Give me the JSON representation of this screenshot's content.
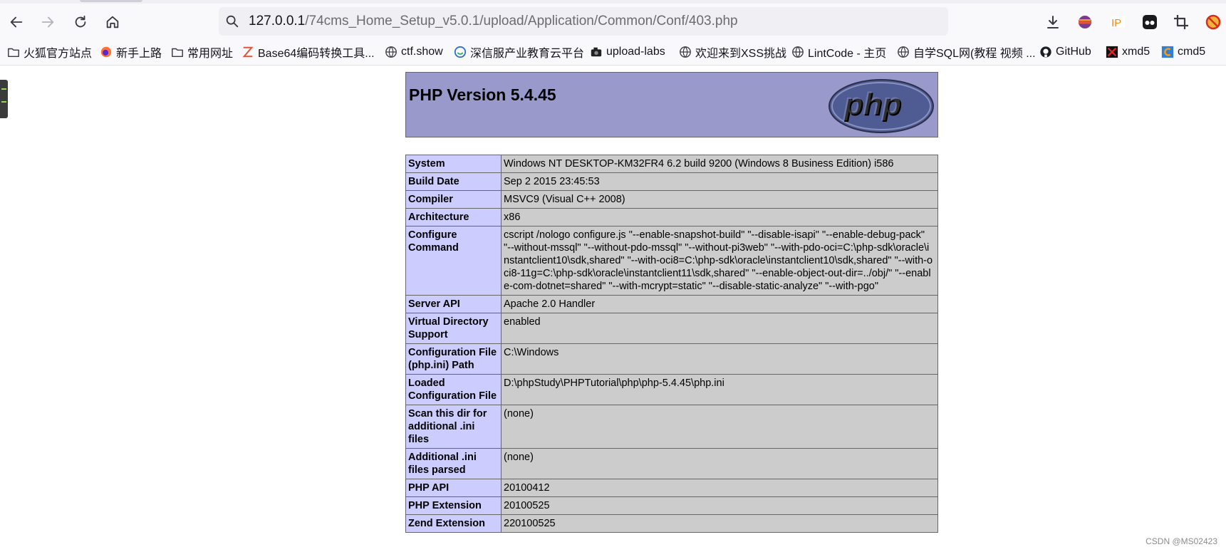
{
  "browser": {
    "url_host": "127.0.0.1",
    "url_path": "/74cms_Home_Setup_v5.0.1/upload/Application/Common/Conf/403.php",
    "bookmarks": [
      {
        "label": "火狐官方站点",
        "icon": "folder-icon"
      },
      {
        "label": "新手上路",
        "icon": "firefox-icon"
      },
      {
        "label": "常用网址",
        "icon": "folder-icon"
      },
      {
        "label": "Base64编码转换工具...",
        "icon": "base64-icon"
      },
      {
        "label": "ctf.show",
        "icon": "globe-icon"
      },
      {
        "label": "深信服产业教育云平台",
        "icon": "sangfor-icon"
      },
      {
        "label": "upload-labs",
        "icon": "camera-icon"
      },
      {
        "label": "欢迎来到XSS挑战",
        "icon": "globe-icon"
      },
      {
        "label": "LintCode - 主页",
        "icon": "globe-icon"
      },
      {
        "label": "自学SQL网(教程 视频 ...",
        "icon": "globe-icon"
      },
      {
        "label": "GitHub",
        "icon": "github-icon"
      },
      {
        "label": "xmd5",
        "icon": "xmd5-icon"
      },
      {
        "label": "cmd5",
        "icon": "cmd5-icon"
      }
    ]
  },
  "phpinfo": {
    "title": "PHP Version 5.4.45",
    "rows": [
      {
        "key": "System",
        "value": "Windows NT DESKTOP-KM32FR4 6.2 build 9200 (Windows 8 Business Edition) i586"
      },
      {
        "key": "Build Date",
        "value": "Sep 2 2015 23:45:53"
      },
      {
        "key": "Compiler",
        "value": "MSVC9 (Visual C++ 2008)"
      },
      {
        "key": "Architecture",
        "value": "x86"
      },
      {
        "key": "Configure Command",
        "value": "cscript /nologo configure.js \"--enable-snapshot-build\" \"--disable-isapi\" \"--enable-debug-pack\" \"--without-mssql\" \"--without-pdo-mssql\" \"--without-pi3web\" \"--with-pdo-oci=C:\\php-sdk\\oracle\\instantclient10\\sdk,shared\" \"--with-oci8=C:\\php-sdk\\oracle\\instantclient10\\sdk,shared\" \"--with-oci8-11g=C:\\php-sdk\\oracle\\instantclient11\\sdk,shared\" \"--enable-object-out-dir=../obj/\" \"--enable-com-dotnet=shared\" \"--with-mcrypt=static\" \"--disable-static-analyze\" \"--with-pgo\""
      },
      {
        "key": "Server API",
        "value": "Apache 2.0 Handler"
      },
      {
        "key": "Virtual Directory Support",
        "value": "enabled"
      },
      {
        "key": "Configuration File (php.ini) Path",
        "value": "C:\\Windows"
      },
      {
        "key": "Loaded Configuration File",
        "value": "D:\\phpStudy\\PHPTutorial\\php\\php-5.4.45\\php.ini"
      },
      {
        "key": "Scan this dir for additional .ini files",
        "value": "(none)"
      },
      {
        "key": "Additional .ini files parsed",
        "value": "(none)"
      },
      {
        "key": "PHP API",
        "value": "20100412"
      },
      {
        "key": "PHP Extension",
        "value": "20100525"
      },
      {
        "key": "Zend Extension",
        "value": "220100525"
      }
    ]
  },
  "watermark": "CSDN @MS02423"
}
